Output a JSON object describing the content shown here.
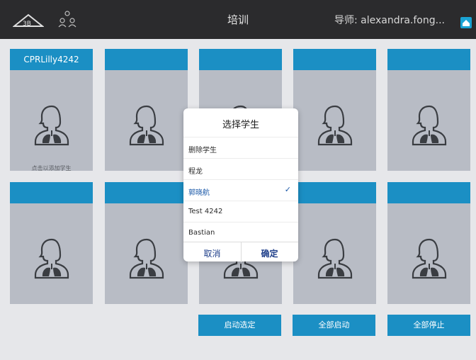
{
  "header": {
    "title": "培训",
    "user": "导师: alexandra.fong...",
    "logo_icon": "3b-logo-icon",
    "group_icon": "users-group-icon",
    "home_icon": "home-icon"
  },
  "stations": [
    {
      "name": "CPRLilly4242",
      "hint": "点击以添加学生"
    },
    {
      "name": "",
      "hint": ""
    },
    {
      "name": "",
      "hint": ""
    },
    {
      "name": "",
      "hint": ""
    },
    {
      "name": "",
      "hint": ""
    },
    {
      "name": "",
      "hint": ""
    },
    {
      "name": "",
      "hint": ""
    },
    {
      "name": "",
      "hint": ""
    },
    {
      "name": "",
      "hint": ""
    },
    {
      "name": "",
      "hint": ""
    }
  ],
  "actions": {
    "start_selected": "启动选定",
    "start_all": "全部启动",
    "stop_all": "全部停止"
  },
  "dialog": {
    "title": "选择学生",
    "options": [
      {
        "label": "删除学生",
        "selected": false
      },
      {
        "label": "程龙",
        "selected": false
      },
      {
        "label": "郭晓航",
        "selected": true
      },
      {
        "label": "Test 4242",
        "selected": false
      },
      {
        "label": "Bastian",
        "selected": false
      }
    ],
    "check_mark": "✓",
    "cancel": "取消",
    "confirm": "确定"
  },
  "colors": {
    "topbar": "#2b2b2d",
    "accent": "#1b8fc4",
    "card_bg": "#b8bcc5",
    "selected_text": "#1a58a8"
  }
}
